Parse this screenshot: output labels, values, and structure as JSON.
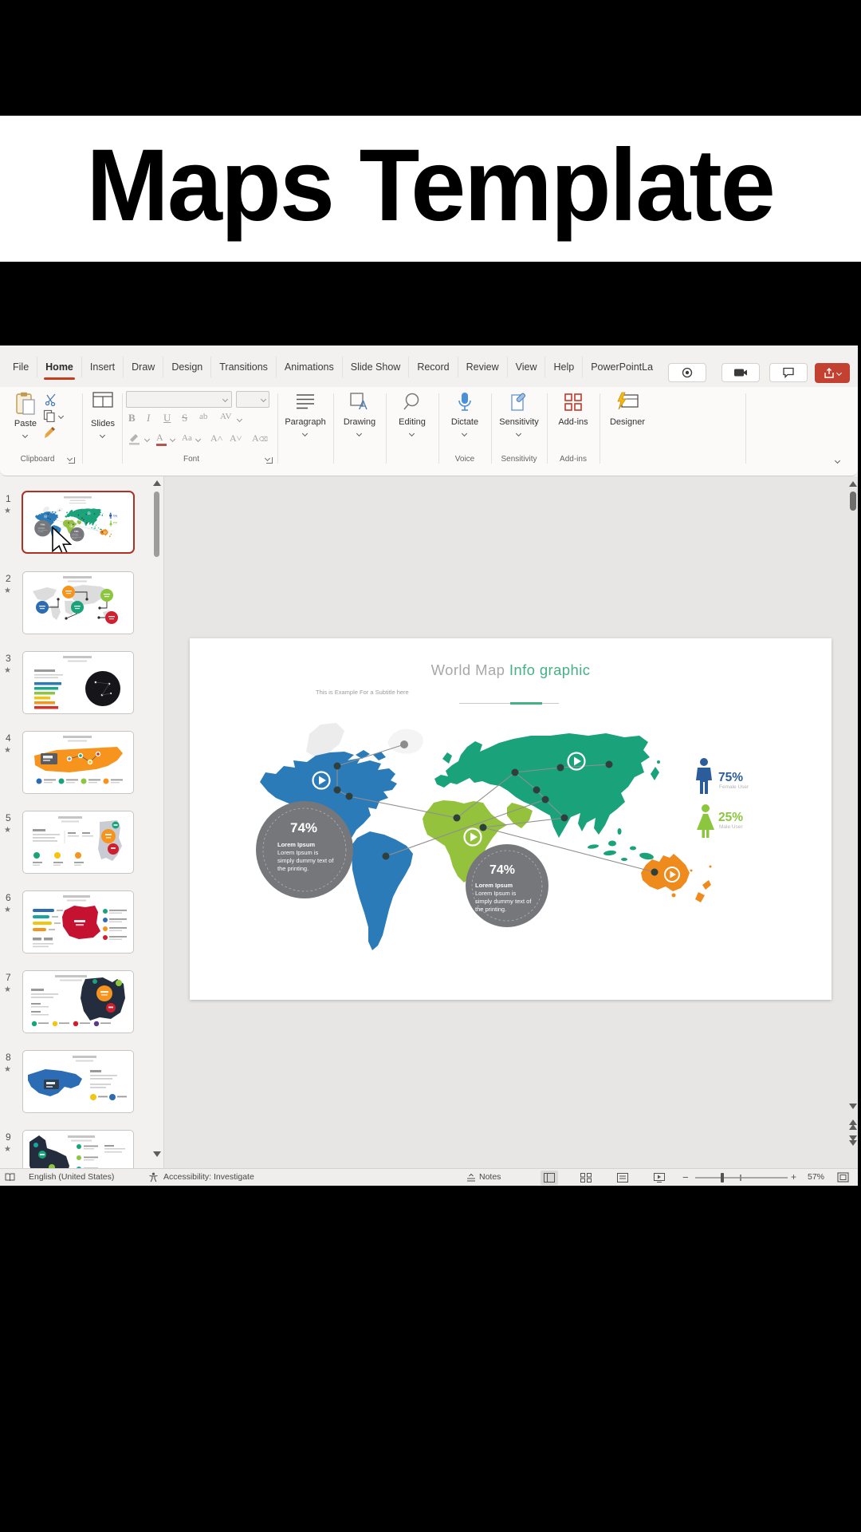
{
  "video": {
    "title": "Maps Template"
  },
  "menu": {
    "tabs": [
      "File",
      "Home",
      "Insert",
      "Draw",
      "Design",
      "Transitions",
      "Animations",
      "Slide Show",
      "Record",
      "Review",
      "View",
      "Help",
      "PowerPointLa"
    ],
    "active_tab": "Home"
  },
  "ribbon": {
    "paste": "Paste",
    "slides": "Slides",
    "paragraph": "Paragraph",
    "drawing": "Drawing",
    "editing": "Editing",
    "dictate": "Dictate",
    "sensitivity": "Sensitivity",
    "addins": "Add-ins",
    "designer": "Designer",
    "bold": "B",
    "italic": "I",
    "underline": "U",
    "strikethrough": "S",
    "shadow": "ab",
    "spacing": "AV",
    "change_case": "Aa",
    "grow_font": "A˄",
    "shrink_font": "A˅",
    "clear_format": "A",
    "font_color": "A",
    "group_clipboard": "Clipboard",
    "group_font": "Font",
    "group_voice": "Voice",
    "group_sensitivity": "Sensitivity",
    "group_addins": "Add-ins"
  },
  "panel": {
    "slide_numbers": [
      "1",
      "2",
      "3",
      "4",
      "5",
      "6",
      "7",
      "8",
      "9"
    ]
  },
  "slide": {
    "title_gray": "World Map ",
    "title_green": "Info graphic",
    "subtitle": "This is Example For a Subtitle here",
    "stat1_value": "74%",
    "stat2_value": "74%",
    "stat_lines": [
      "Lorem Ipsum",
      "Lorem Ipsum is",
      "simply dummy text of",
      "the printing."
    ],
    "legend_top_value": "75%",
    "legend_top_label": "Female User",
    "legend_bottom_value": "25%",
    "legend_bottom_label": "Male User"
  },
  "status": {
    "language": "English (United States)",
    "accessibility": "Accessibility: Investigate",
    "notes": "Notes",
    "zoom_level": "57%"
  },
  "colors": {
    "accent_red": "#c43e1c",
    "map_blue": "#2b7bb9",
    "map_green": "#1aa37a",
    "map_light_green": "#95c23d",
    "map_orange": "#ef8a1d",
    "stat_circle_gray": "#75777b",
    "legend_blue": "#2b5d9b",
    "legend_green": "#8cc63f"
  }
}
